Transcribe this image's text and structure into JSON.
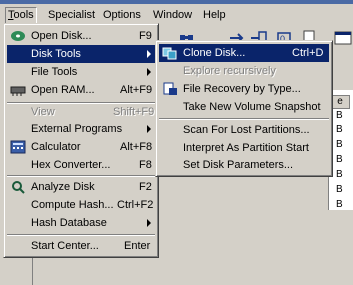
{
  "menubar": {
    "items": [
      "Tools",
      "Specialist",
      "Options",
      "Window",
      "Help"
    ]
  },
  "background": {
    "column_header": "e",
    "cell_values": [
      "B",
      "B",
      "B",
      "B",
      "B",
      "B",
      "B"
    ]
  },
  "tools_menu": {
    "items": [
      {
        "label": "Open Disk...",
        "shortcut": "F9"
      },
      {
        "label": "Disk Tools",
        "shortcut": ""
      },
      {
        "label": "File Tools",
        "shortcut": ""
      },
      {
        "label": "Open RAM...",
        "shortcut": "Alt+F9"
      },
      {
        "label": "View",
        "shortcut": "Shift+F9"
      },
      {
        "label": "External Programs",
        "shortcut": ""
      },
      {
        "label": "Calculator",
        "shortcut": "Alt+F8"
      },
      {
        "label": "Hex Converter...",
        "shortcut": "F8"
      },
      {
        "label": "Analyze Disk",
        "shortcut": "F2"
      },
      {
        "label": "Compute Hash...",
        "shortcut": "Ctrl+F2"
      },
      {
        "label": "Hash Database",
        "shortcut": ""
      },
      {
        "label": "Start Center...",
        "shortcut": "Enter"
      }
    ]
  },
  "disk_tools_menu": {
    "items": [
      {
        "label": "Clone Disk...",
        "shortcut": "Ctrl+D"
      },
      {
        "label": "Explore recursively",
        "shortcut": ""
      },
      {
        "label": "File Recovery by Type...",
        "shortcut": ""
      },
      {
        "label": "Take New Volume Snapshot",
        "shortcut": ""
      },
      {
        "label": "Scan For Lost Partitions...",
        "shortcut": ""
      },
      {
        "label": "Interpret As Partition Start",
        "shortcut": ""
      },
      {
        "label": "Set Disk Parameters...",
        "shortcut": ""
      }
    ]
  },
  "colors": {
    "highlight": "#0a246a",
    "face": "#d4d0c8",
    "disabled": "#808080"
  }
}
